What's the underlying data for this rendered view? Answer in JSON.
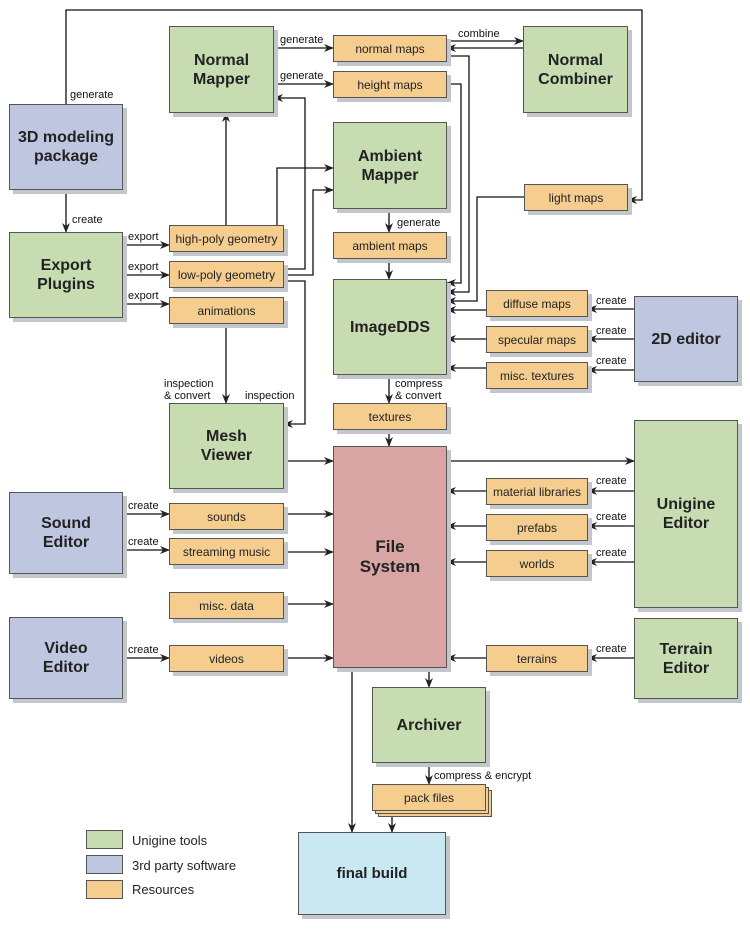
{
  "nodes": {
    "normal_mapper": "Normal\nMapper",
    "normal_maps": "normal maps",
    "height_maps": "height maps",
    "normal_combiner": "Normal\nCombiner",
    "modeling_package": "3D modeling\npackage",
    "ambient_mapper": "Ambient\nMapper",
    "light_maps": "light maps",
    "export_plugins": "Export\nPlugins",
    "high_poly": "high-poly geometry",
    "low_poly": "low-poly geometry",
    "animations": "animations",
    "ambient_maps": "ambient maps",
    "imagedds": "ImageDDS",
    "diffuse_maps": "diffuse maps",
    "specular_maps": "specular maps",
    "misc_textures": "misc. textures",
    "editor_2d": "2D editor",
    "textures": "textures",
    "mesh_viewer": "Mesh\nViewer",
    "file_system": "File\nSystem",
    "unigine_editor": "Unigine\nEditor",
    "material_libraries": "material libraries",
    "prefabs": "prefabs",
    "worlds": "worlds",
    "sound_editor": "Sound\nEditor",
    "sounds": "sounds",
    "streaming_music": "streaming music",
    "misc_data": "misc. data",
    "video_editor": "Video\nEditor",
    "videos": "videos",
    "terrains": "terrains",
    "terrain_editor": "Terrain\nEditor",
    "archiver": "Archiver",
    "pack_files": "pack files",
    "final_build": "final build"
  },
  "edge_labels": {
    "generate": "generate",
    "create": "create",
    "export": "export",
    "combine": "combine",
    "inspection": "inspection",
    "inspection_convert_1": "inspection",
    "inspection_convert_2": "& convert",
    "compress_1": "compress",
    "compress_2": "& convert",
    "compress_encrypt": "compress & encrypt"
  },
  "legend": [
    {
      "label": "Unigine tools",
      "color": "#c7ddb1"
    },
    {
      "label": "3rd party software",
      "color": "#bfc7e0"
    },
    {
      "label": "Resources",
      "color": "#f5cd8f"
    }
  ]
}
